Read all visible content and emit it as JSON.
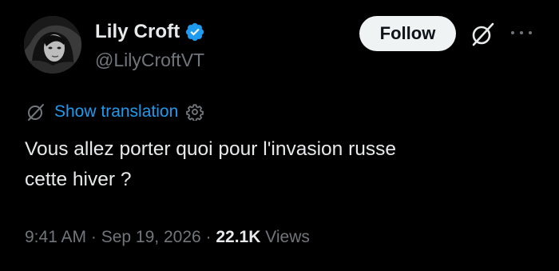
{
  "author": {
    "display_name": "Lily Croft",
    "handle": "@LilyCroftVT",
    "verified": true,
    "verified_color": "#1d9bf0"
  },
  "actions": {
    "follow_label": "Follow",
    "grok_icon": "slashed-circle-icon",
    "more_icon": "more-dots-icon"
  },
  "translation": {
    "label": "Show translation",
    "icon": "slashed-circle-icon",
    "settings_icon": "gear-icon",
    "link_color": "#1d9bf0"
  },
  "tweet": {
    "text": "Vous allez porter quoi pour l'invasion russe\ncette hiver ?"
  },
  "meta": {
    "time": "9:41 AM",
    "separator": " · ",
    "date": "Sep 19, 2026",
    "views_count": "22.1K",
    "views_label": "Views"
  },
  "colors": {
    "background": "#000000",
    "primary_text": "#e7e9ea",
    "secondary_text": "#71767b",
    "button_bg": "#eff3f4"
  }
}
